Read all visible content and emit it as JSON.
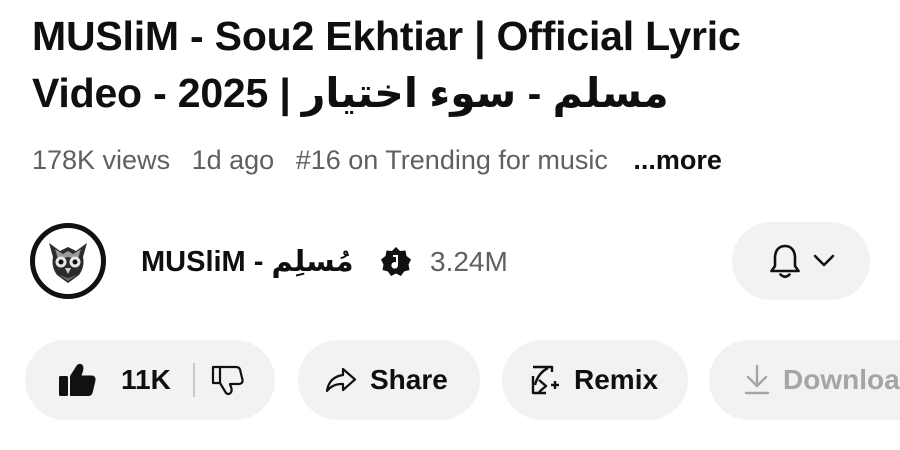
{
  "video": {
    "title_line1": "MUSliM - Sou2 Ekhtiar | Official Lyric",
    "title_line2": "Video - 2025 | مسلم - سوء اختيار",
    "views": "178K views",
    "age": "1d ago",
    "trending": "#16 on Trending for music",
    "more_label": "...more"
  },
  "channel": {
    "name": "MUSliM - مُسلِم",
    "subscribers": "3.24M",
    "avatar_icon": "owl-logo-icon",
    "verified_icon": "verified-music-badge-icon"
  },
  "notifications": {
    "bell_icon": "bell-icon",
    "chevron_icon": "chevron-down-icon"
  },
  "actions": {
    "like_count": "11K",
    "share_label": "Share",
    "remix_label": "Remix",
    "download_label": "Download"
  },
  "colors": {
    "text_primary": "#0f0f0f",
    "text_secondary": "#606060",
    "pill_background": "#f2f2f2",
    "disabled_text": "#a5a5a5"
  }
}
